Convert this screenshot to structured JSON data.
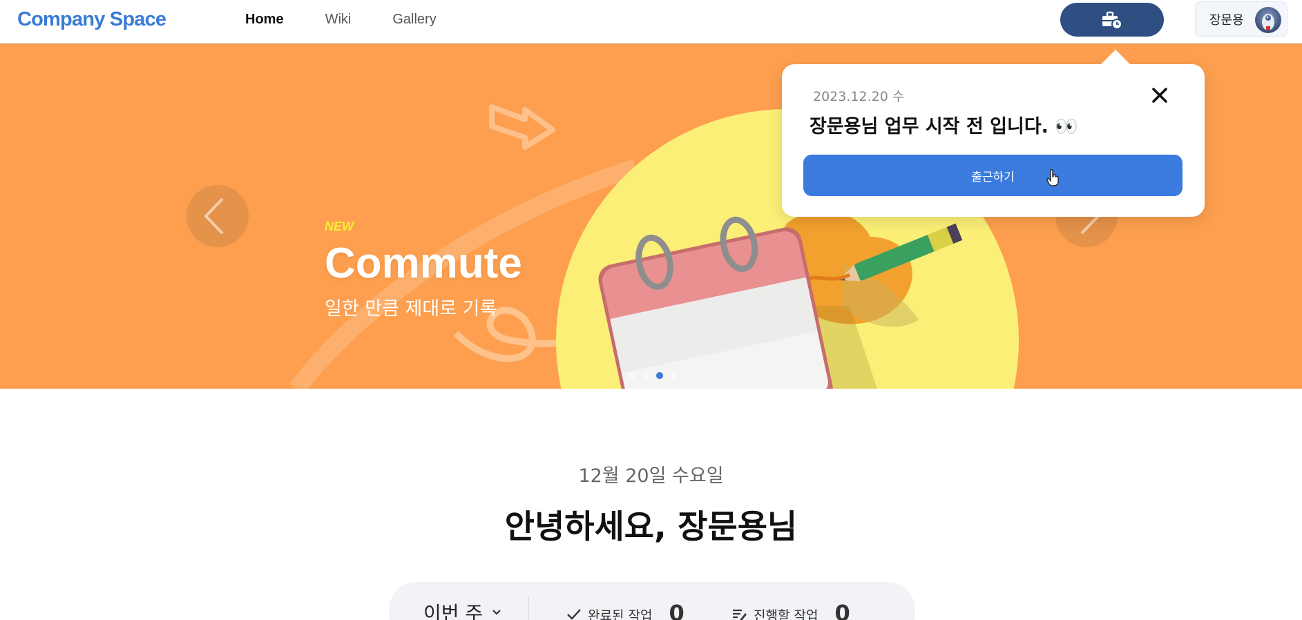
{
  "header": {
    "logo": "Company Space",
    "nav": [
      "Home",
      "Wiki",
      "Gallery"
    ],
    "active_nav": "Home",
    "commute_icon": "briefcase-clock-icon",
    "user_name": "장문용"
  },
  "banner": {
    "badge": "NEW",
    "title": "Commute",
    "subtitle": "일한 만큼 제대로 기록",
    "slide_count": 4,
    "active_slide": 3,
    "prev_icon": "chevron-left-icon",
    "next_icon": "chevron-right-icon",
    "background_color": "#fd9f4e",
    "accent_color": "#f8ee3a"
  },
  "popover": {
    "date": "2023.12.20 수",
    "message": "장문용님 업무 시작 전 입니다. 👀",
    "close_icon": "close-icon",
    "cta_label": "출근하기",
    "cta_color": "#3a7bdd"
  },
  "greeting": {
    "date": "12월 20일 수요일",
    "title": "안녕하세요, 장문용님"
  },
  "stats": {
    "period": "이번 주",
    "completed_label": "완료된 작업",
    "completed_value": "0",
    "pending_label": "진행할 작업",
    "pending_value": "0"
  }
}
